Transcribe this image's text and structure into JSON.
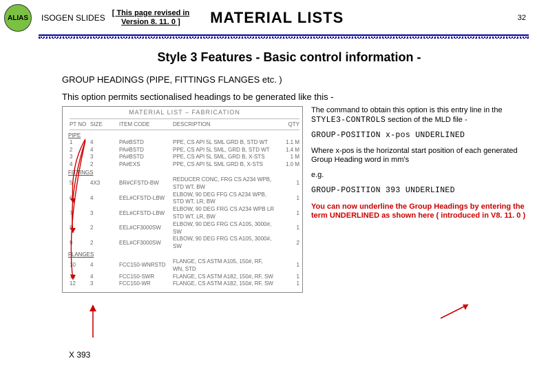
{
  "header": {
    "logo": "ALIAS",
    "brand": "ISOGEN SLIDES",
    "revision_line1": "[ This page revised  in",
    "revision_line2": "Version 8. 11. 0 ]",
    "title": "MATERIAL LISTS",
    "page_number": "32"
  },
  "subtitle": "Style 3 Features - Basic control information -",
  "section": {
    "heading": "GROUP HEADINGS (PIPE, FITTINGS FLANGES etc. )",
    "lead": "This option permits sectionalised headings to be generated like this -"
  },
  "figure": {
    "title": "MATERIAL LIST  –  FABRICATION",
    "columns": [
      "PT NO",
      "SIZE",
      "ITEM  CODE",
      "DESCRIPTION",
      "QTY"
    ],
    "groups": [
      {
        "name": "PIPE",
        "rows": [
          {
            "pt": "1",
            "size": "4",
            "code": "PA#BSTD",
            "desc": "PPE, CS API 5L SML GRD B, STD WT",
            "qty": "1.1 M"
          },
          {
            "pt": "2",
            "size": "4",
            "code": "PA#BSTD",
            "desc": "PPE, CS API 5L SML, GRD B, STD WT",
            "qty": "1.4 M"
          },
          {
            "pt": "3",
            "size": "3",
            "code": "PA#BSTD",
            "desc": "PPE, CS API 5L SML, GRD B, X-STS",
            "qty": "1 M"
          },
          {
            "pt": "4",
            "size": "2",
            "code": "PA#EXS",
            "desc": "PPE, CS API 5L SML GRD B, X-STS",
            "qty": "1.0 M"
          }
        ]
      },
      {
        "name": "FITTINGS",
        "rows": [
          {
            "pt": "5",
            "size": "4X3",
            "code": "BR#CFSTD-BW",
            "desc": "REDUCER CONC, FRG CS A234 WPB, STD WT, BW",
            "qty": "1"
          },
          {
            "pt": "6",
            "size": "4",
            "code": "EEL#CFSTD-LBW",
            "desc": "ELBOW, 90 DEG FFG CS A234 WPB, STD WT, LR, BW",
            "qty": "1"
          },
          {
            "pt": "7",
            "size": "3",
            "code": "EEL#CFSTD-LBW",
            "desc": "ELBOW, 90 DEG FRG CS A234 WPB LR STD WT, LR, BW",
            "qty": "1"
          },
          {
            "pt": "8",
            "size": "2",
            "code": "EEL#CF3000SW",
            "desc": "ELBOW, 90 DEG FRG CS A105, 3000#, SW",
            "qty": "1"
          },
          {
            "pt": "9",
            "size": "2",
            "code": "EEL#CF3000SW",
            "desc": "ELBOW, 90 DEG FRG CS A105, 3000#, SW",
            "qty": "2"
          }
        ]
      },
      {
        "name": "FLANGES",
        "rows": [
          {
            "pt": "10",
            "size": "4",
            "code": "FCC150-WNRSTD",
            "desc": "FLANGE, CS ASTM A105, 150#, RF, WN, STD",
            "qty": "1"
          },
          {
            "pt": "11",
            "size": "4",
            "code": "FCC150-SWR",
            "desc": "FLANGE, CS ASTM A182, 150#, RF, SW",
            "qty": "1"
          },
          {
            "pt": "12",
            "size": "3",
            "code": "FCC150-WR",
            "desc": "FLANGE, CS ASTM A182, 150#, RF, SW",
            "qty": "1"
          }
        ]
      }
    ]
  },
  "right_col": {
    "p1a": "The command to obtain this option is this entry line in the ",
    "p1b": "STYLE3-CONTROLS",
    "p1c": " section of the MLD file -",
    "code1": "GROUP-POSITION  x-pos UNDERLINED",
    "p2": "Where x-pos is the horizontal start position of each generated Group Heading word in mm's",
    "eg": "e.g.",
    "code2": "GROUP-POSITION   393  UNDERLINED",
    "note": "You can now underline the Group Headings by entering the term UNDERLINED as shown here ( introduced in V8. 11. 0 )"
  },
  "xpos_label": "X 393"
}
